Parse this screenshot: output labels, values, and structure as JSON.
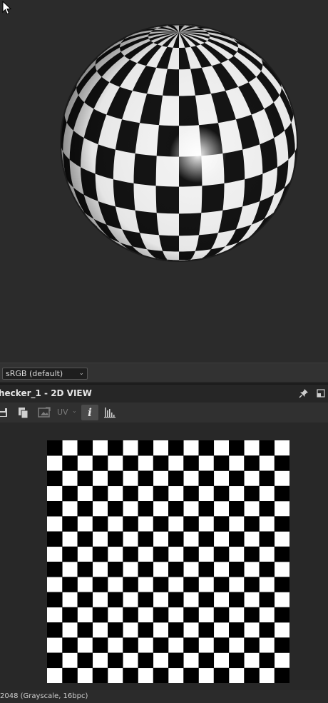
{
  "viewport": {
    "cursor_icon": "arrow-cursor-icon",
    "sphere_preview": "checker-sphere"
  },
  "colorspace": {
    "selected": "sRGB (default)"
  },
  "panel": {
    "title": "hecker_1 - 2D VIEW",
    "pin_icon": "pin-icon",
    "maximize_icon": "maximize-icon"
  },
  "toolbar": {
    "icons": [
      "save-icon",
      "copy-icon",
      "image-refresh-icon",
      "info-icon",
      "histogram-icon"
    ],
    "uv_label": "UV",
    "info_label": "i"
  },
  "view2d": {
    "checker_columns": 16,
    "checker_rows": 16
  },
  "status": {
    "text": "2048 (Grayscale, 16bpc)"
  },
  "colors": {
    "background": "#2b2b2b",
    "panel": "#262626",
    "toolbar": "#303030",
    "checker_dark": "#000000",
    "checker_light": "#ffffff"
  }
}
